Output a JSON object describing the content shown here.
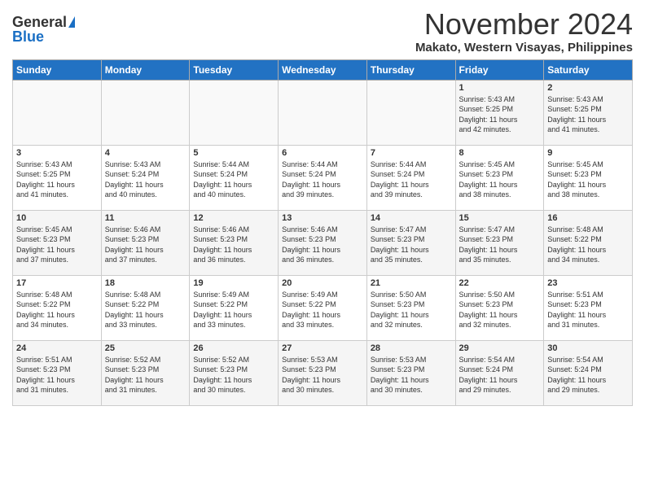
{
  "header": {
    "logo_general": "General",
    "logo_blue": "Blue",
    "month": "November 2024",
    "location": "Makato, Western Visayas, Philippines"
  },
  "calendar": {
    "days_of_week": [
      "Sunday",
      "Monday",
      "Tuesday",
      "Wednesday",
      "Thursday",
      "Friday",
      "Saturday"
    ],
    "weeks": [
      [
        {
          "day": "",
          "content": ""
        },
        {
          "day": "",
          "content": ""
        },
        {
          "day": "",
          "content": ""
        },
        {
          "day": "",
          "content": ""
        },
        {
          "day": "",
          "content": ""
        },
        {
          "day": "1",
          "content": "Sunrise: 5:43 AM\nSunset: 5:25 PM\nDaylight: 11 hours\nand 42 minutes."
        },
        {
          "day": "2",
          "content": "Sunrise: 5:43 AM\nSunset: 5:25 PM\nDaylight: 11 hours\nand 41 minutes."
        }
      ],
      [
        {
          "day": "3",
          "content": "Sunrise: 5:43 AM\nSunset: 5:25 PM\nDaylight: 11 hours\nand 41 minutes."
        },
        {
          "day": "4",
          "content": "Sunrise: 5:43 AM\nSunset: 5:24 PM\nDaylight: 11 hours\nand 40 minutes."
        },
        {
          "day": "5",
          "content": "Sunrise: 5:44 AM\nSunset: 5:24 PM\nDaylight: 11 hours\nand 40 minutes."
        },
        {
          "day": "6",
          "content": "Sunrise: 5:44 AM\nSunset: 5:24 PM\nDaylight: 11 hours\nand 39 minutes."
        },
        {
          "day": "7",
          "content": "Sunrise: 5:44 AM\nSunset: 5:24 PM\nDaylight: 11 hours\nand 39 minutes."
        },
        {
          "day": "8",
          "content": "Sunrise: 5:45 AM\nSunset: 5:23 PM\nDaylight: 11 hours\nand 38 minutes."
        },
        {
          "day": "9",
          "content": "Sunrise: 5:45 AM\nSunset: 5:23 PM\nDaylight: 11 hours\nand 38 minutes."
        }
      ],
      [
        {
          "day": "10",
          "content": "Sunrise: 5:45 AM\nSunset: 5:23 PM\nDaylight: 11 hours\nand 37 minutes."
        },
        {
          "day": "11",
          "content": "Sunrise: 5:46 AM\nSunset: 5:23 PM\nDaylight: 11 hours\nand 37 minutes."
        },
        {
          "day": "12",
          "content": "Sunrise: 5:46 AM\nSunset: 5:23 PM\nDaylight: 11 hours\nand 36 minutes."
        },
        {
          "day": "13",
          "content": "Sunrise: 5:46 AM\nSunset: 5:23 PM\nDaylight: 11 hours\nand 36 minutes."
        },
        {
          "day": "14",
          "content": "Sunrise: 5:47 AM\nSunset: 5:23 PM\nDaylight: 11 hours\nand 35 minutes."
        },
        {
          "day": "15",
          "content": "Sunrise: 5:47 AM\nSunset: 5:23 PM\nDaylight: 11 hours\nand 35 minutes."
        },
        {
          "day": "16",
          "content": "Sunrise: 5:48 AM\nSunset: 5:22 PM\nDaylight: 11 hours\nand 34 minutes."
        }
      ],
      [
        {
          "day": "17",
          "content": "Sunrise: 5:48 AM\nSunset: 5:22 PM\nDaylight: 11 hours\nand 34 minutes."
        },
        {
          "day": "18",
          "content": "Sunrise: 5:48 AM\nSunset: 5:22 PM\nDaylight: 11 hours\nand 33 minutes."
        },
        {
          "day": "19",
          "content": "Sunrise: 5:49 AM\nSunset: 5:22 PM\nDaylight: 11 hours\nand 33 minutes."
        },
        {
          "day": "20",
          "content": "Sunrise: 5:49 AM\nSunset: 5:22 PM\nDaylight: 11 hours\nand 33 minutes."
        },
        {
          "day": "21",
          "content": "Sunrise: 5:50 AM\nSunset: 5:23 PM\nDaylight: 11 hours\nand 32 minutes."
        },
        {
          "day": "22",
          "content": "Sunrise: 5:50 AM\nSunset: 5:23 PM\nDaylight: 11 hours\nand 32 minutes."
        },
        {
          "day": "23",
          "content": "Sunrise: 5:51 AM\nSunset: 5:23 PM\nDaylight: 11 hours\nand 31 minutes."
        }
      ],
      [
        {
          "day": "24",
          "content": "Sunrise: 5:51 AM\nSunset: 5:23 PM\nDaylight: 11 hours\nand 31 minutes."
        },
        {
          "day": "25",
          "content": "Sunrise: 5:52 AM\nSunset: 5:23 PM\nDaylight: 11 hours\nand 31 minutes."
        },
        {
          "day": "26",
          "content": "Sunrise: 5:52 AM\nSunset: 5:23 PM\nDaylight: 11 hours\nand 30 minutes."
        },
        {
          "day": "27",
          "content": "Sunrise: 5:53 AM\nSunset: 5:23 PM\nDaylight: 11 hours\nand 30 minutes."
        },
        {
          "day": "28",
          "content": "Sunrise: 5:53 AM\nSunset: 5:23 PM\nDaylight: 11 hours\nand 30 minutes."
        },
        {
          "day": "29",
          "content": "Sunrise: 5:54 AM\nSunset: 5:24 PM\nDaylight: 11 hours\nand 29 minutes."
        },
        {
          "day": "30",
          "content": "Sunrise: 5:54 AM\nSunset: 5:24 PM\nDaylight: 11 hours\nand 29 minutes."
        }
      ]
    ]
  }
}
